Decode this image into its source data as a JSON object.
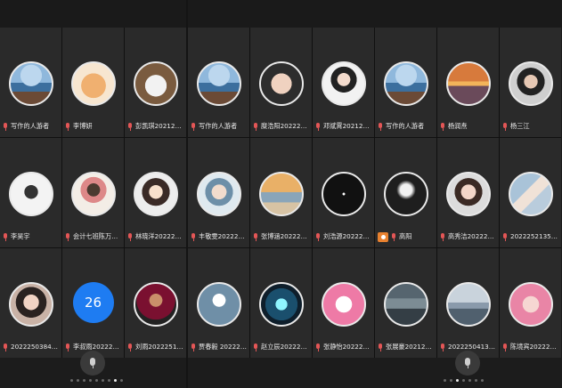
{
  "left_panel": {
    "tiles": [
      {
        "name": "写作的人游者",
        "avatar": "ocean"
      },
      {
        "name": "李博妍",
        "avatar": "cat"
      },
      {
        "name": "彭凯琪2021233...",
        "avatar": "duck"
      },
      {
        "name": "李昊宇",
        "avatar": "meme"
      },
      {
        "name": "会计七班陈万金...",
        "avatar": "girl"
      },
      {
        "name": "林晓洋2022251...",
        "avatar": "anime"
      },
      {
        "name": "2022250384杨...",
        "avatar": "woman"
      },
      {
        "name": "李叔雨2022251...",
        "avatar_text": "26"
      },
      {
        "name": "刘雨2022251012",
        "avatar": "player"
      }
    ],
    "page_count": 9,
    "active_page": 8
  },
  "right_panel": {
    "tiles": [
      {
        "name": "写作的人游者",
        "avatar": "ocean"
      },
      {
        "name": "糜浩阳2022251650",
        "avatar": "hands"
      },
      {
        "name": "邓斌霄2021212...",
        "avatar": "portrait"
      },
      {
        "name": "写作的人游者",
        "avatar": "ocean"
      },
      {
        "name": "杨润焘",
        "avatar": "sunset"
      },
      {
        "name": "杨三江",
        "avatar": "man"
      },
      {
        "name": "丰敬雯2022250...",
        "avatar": "boy"
      },
      {
        "name": "张博涵2022250912",
        "avatar": "beach"
      },
      {
        "name": "刘浩源2022223...",
        "avatar": "darkring"
      },
      {
        "name": "高阳",
        "avatar": "tunnel",
        "host": true
      },
      {
        "name": "高秀洁2022252...",
        "avatar": "smile"
      },
      {
        "name": "2022252135王...",
        "avatar": "hand"
      },
      {
        "name": "贾春毅 2022250...",
        "avatar": "dandelion"
      },
      {
        "name": "赵立辰2022250...",
        "avatar": "glow"
      },
      {
        "name": "张静怡2022252...",
        "avatar": "cartoon"
      },
      {
        "name": "张展豪2021263...",
        "avatar": "sea"
      },
      {
        "name": "2022250413潘...",
        "avatar": "lake"
      },
      {
        "name": "陈境宾2022251...",
        "avatar": "pinkgirl"
      }
    ],
    "page_count": 7,
    "active_page": 3
  },
  "icons": {
    "mic_icon": "mic-red",
    "float_mic": "mic-icon"
  },
  "colors": {
    "mic_red": "#e35656",
    "host_orange": "#e8812f",
    "count_blue": "#1e7cf2"
  }
}
